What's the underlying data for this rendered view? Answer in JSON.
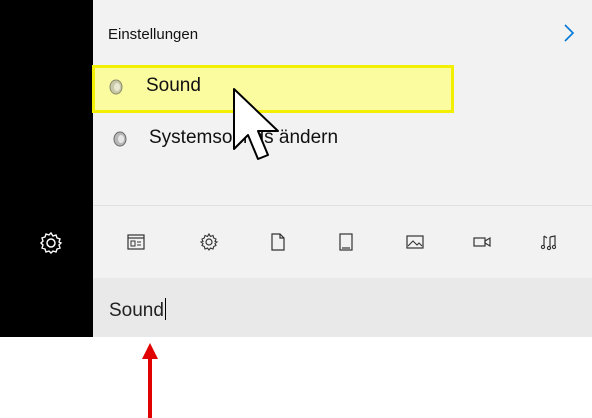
{
  "panel": {
    "header_label": "Einstellungen",
    "results": [
      {
        "label": "Sound",
        "selected": true
      },
      {
        "label": "Systemsounds ändern",
        "selected": false
      }
    ]
  },
  "filters": [
    {
      "icon": "apps-icon"
    },
    {
      "icon": "settings-gear-icon"
    },
    {
      "icon": "document-icon"
    },
    {
      "icon": "device-icon"
    },
    {
      "icon": "photo-icon"
    },
    {
      "icon": "video-icon"
    },
    {
      "icon": "music-icon"
    }
  ],
  "search": {
    "value": "Sound"
  },
  "colors": {
    "highlight_fill": "#fbfca0",
    "highlight_border": "#f2f000",
    "accent": "#0078d7",
    "annotation_arrow": "#e00000"
  }
}
